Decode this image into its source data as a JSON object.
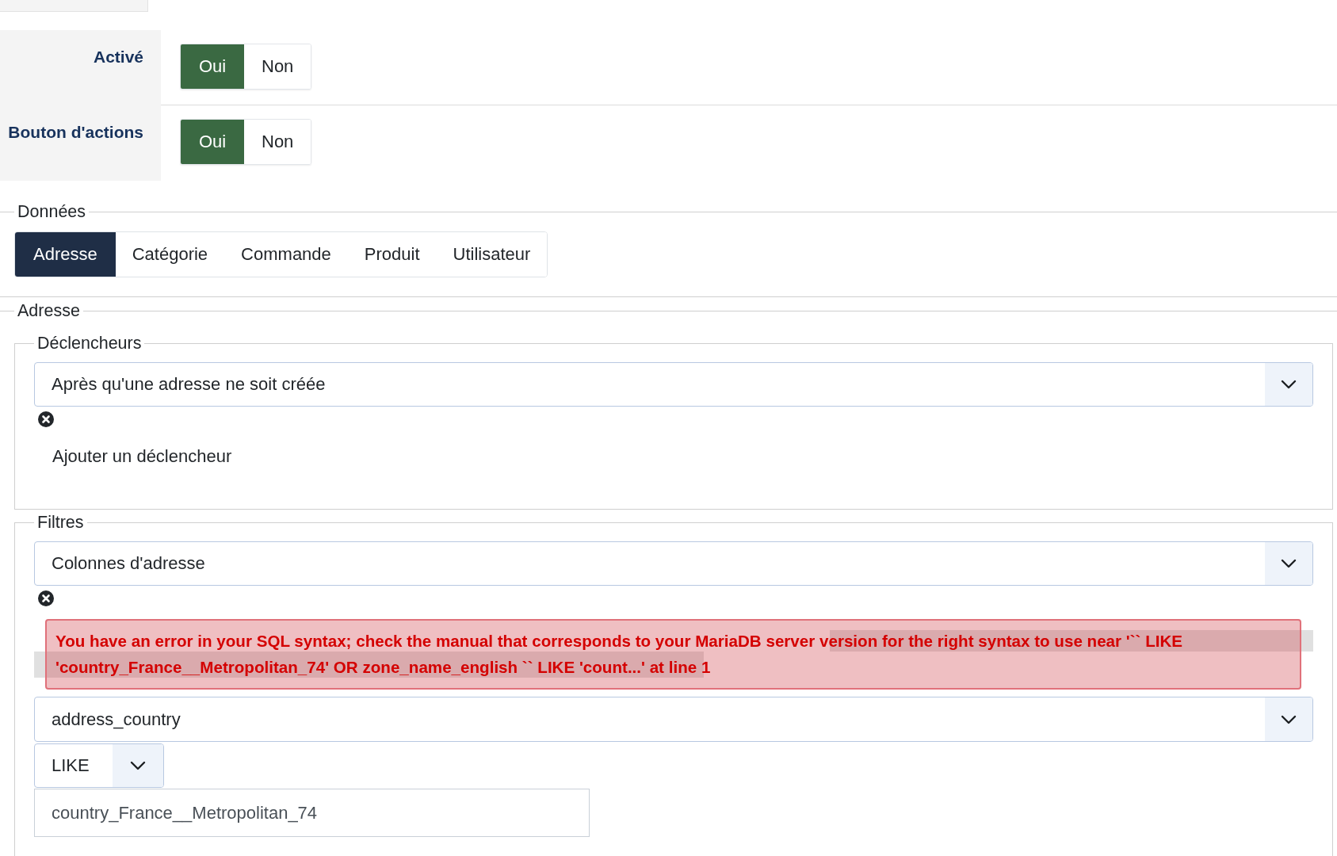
{
  "settings": [
    {
      "label": "Activé",
      "options": [
        {
          "label": "Oui",
          "selected": true
        },
        {
          "label": "Non",
          "selected": false
        }
      ]
    },
    {
      "label": "Bouton d'actions",
      "options": [
        {
          "label": "Oui",
          "selected": true
        },
        {
          "label": "Non",
          "selected": false
        }
      ]
    }
  ],
  "data_section": {
    "legend": "Données",
    "tabs": [
      {
        "label": "Adresse",
        "selected": true
      },
      {
        "label": "Catégorie",
        "selected": false
      },
      {
        "label": "Commande",
        "selected": false
      },
      {
        "label": "Produit",
        "selected": false
      },
      {
        "label": "Utilisateur",
        "selected": false
      }
    ]
  },
  "address_section": {
    "legend": "Adresse",
    "triggers": {
      "legend": "Déclencheurs",
      "items": [
        {
          "value": "Après qu'une adresse ne soit créée"
        }
      ],
      "add_link": "Ajouter un déclencheur"
    },
    "filters": {
      "legend": "Filtres",
      "items": [
        {
          "value": "Colonnes d'adresse",
          "error": "You have an error in your SQL syntax; check the manual that corresponds to your MariaDB server version for the right syntax to use near '`` LIKE 'country_France__Metropolitan_74' OR zone_name_english `` LIKE 'count...' at line 1",
          "column": "address_country",
          "operator": "LIKE",
          "input_value": "country_France__Metropolitan_74"
        }
      ]
    }
  }
}
